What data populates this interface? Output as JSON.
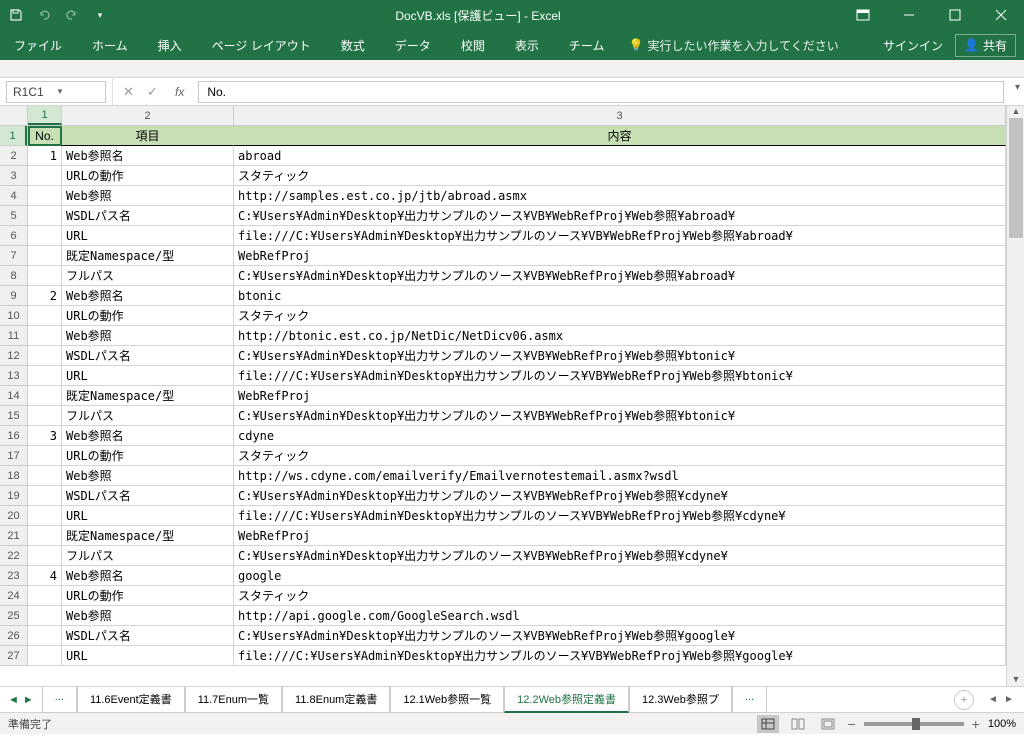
{
  "title": "DocVB.xls [保護ビュー] - Excel",
  "qat": {
    "save": "save",
    "undo": "undo",
    "redo": "redo"
  },
  "tabs": {
    "file": "ファイル",
    "home": "ホーム",
    "insert": "挿入",
    "pageLayout": "ページ レイアウト",
    "formulas": "数式",
    "data": "データ",
    "review": "校閲",
    "view": "表示",
    "team": "チーム"
  },
  "search_placeholder": "実行したい作業を入力してください",
  "signin": "サインイン",
  "share": "共有",
  "nameBox": "R1C1",
  "formula": "No.",
  "colHeaders": [
    "1",
    "2",
    "3"
  ],
  "rowHeaders": [
    "1",
    "2",
    "3",
    "4",
    "5",
    "6",
    "7",
    "8",
    "9",
    "10",
    "11",
    "12",
    "13",
    "14",
    "15",
    "16",
    "17",
    "18",
    "19",
    "20",
    "21",
    "22",
    "23",
    "24",
    "25",
    "26",
    "27"
  ],
  "headerRow": {
    "c1": "No.",
    "c2": "項目",
    "c3": "内容"
  },
  "rows": [
    {
      "n": "1",
      "k": "Web参照名",
      "v": "abroad"
    },
    {
      "n": "",
      "k": "URLの動作",
      "v": "スタティック"
    },
    {
      "n": "",
      "k": "Web参照",
      "v": "http://samples.est.co.jp/jtb/abroad.asmx"
    },
    {
      "n": "",
      "k": "WSDLパス名",
      "v": "C:¥Users¥Admin¥Desktop¥出力サンプルのソース¥VB¥WebRefProj¥Web参照¥abroad¥"
    },
    {
      "n": "",
      "k": "URL",
      "v": "file:///C:¥Users¥Admin¥Desktop¥出力サンプルのソース¥VB¥WebRefProj¥Web参照¥abroad¥"
    },
    {
      "n": "",
      "k": "既定Namespace/型",
      "v": "WebRefProj"
    },
    {
      "n": "",
      "k": "フルパス",
      "v": "C:¥Users¥Admin¥Desktop¥出力サンプルのソース¥VB¥WebRefProj¥Web参照¥abroad¥"
    },
    {
      "n": "2",
      "k": "Web参照名",
      "v": "btonic"
    },
    {
      "n": "",
      "k": "URLの動作",
      "v": "スタティック"
    },
    {
      "n": "",
      "k": "Web参照",
      "v": "http://btonic.est.co.jp/NetDic/NetDicv06.asmx"
    },
    {
      "n": "",
      "k": "WSDLパス名",
      "v": "C:¥Users¥Admin¥Desktop¥出力サンプルのソース¥VB¥WebRefProj¥Web参照¥btonic¥"
    },
    {
      "n": "",
      "k": "URL",
      "v": "file:///C:¥Users¥Admin¥Desktop¥出力サンプルのソース¥VB¥WebRefProj¥Web参照¥btonic¥"
    },
    {
      "n": "",
      "k": "既定Namespace/型",
      "v": "WebRefProj"
    },
    {
      "n": "",
      "k": "フルパス",
      "v": "C:¥Users¥Admin¥Desktop¥出力サンプルのソース¥VB¥WebRefProj¥Web参照¥btonic¥"
    },
    {
      "n": "3",
      "k": "Web参照名",
      "v": "cdyne"
    },
    {
      "n": "",
      "k": "URLの動作",
      "v": "スタティック"
    },
    {
      "n": "",
      "k": "Web参照",
      "v": "http://ws.cdyne.com/emailverify/Emailvernotestemail.asmx?wsdl"
    },
    {
      "n": "",
      "k": "WSDLパス名",
      "v": "C:¥Users¥Admin¥Desktop¥出力サンプルのソース¥VB¥WebRefProj¥Web参照¥cdyne¥"
    },
    {
      "n": "",
      "k": "URL",
      "v": "file:///C:¥Users¥Admin¥Desktop¥出力サンプルのソース¥VB¥WebRefProj¥Web参照¥cdyne¥"
    },
    {
      "n": "",
      "k": "既定Namespace/型",
      "v": "WebRefProj"
    },
    {
      "n": "",
      "k": "フルパス",
      "v": "C:¥Users¥Admin¥Desktop¥出力サンプルのソース¥VB¥WebRefProj¥Web参照¥cdyne¥"
    },
    {
      "n": "4",
      "k": "Web参照名",
      "v": "google"
    },
    {
      "n": "",
      "k": "URLの動作",
      "v": "スタティック"
    },
    {
      "n": "",
      "k": "Web参照",
      "v": "http://api.google.com/GoogleSearch.wsdl"
    },
    {
      "n": "",
      "k": "WSDLパス名",
      "v": "C:¥Users¥Admin¥Desktop¥出力サンプルのソース¥VB¥WebRefProj¥Web参照¥google¥"
    },
    {
      "n": "",
      "k": "URL",
      "v": "file:///C:¥Users¥Admin¥Desktop¥出力サンプルのソース¥VB¥WebRefProj¥Web参照¥google¥"
    }
  ],
  "sheets": {
    "s0": "...",
    "s1": "11.6Event定義書",
    "s2": "11.7Enum一覧",
    "s3": "11.8Enum定義書",
    "s4": "12.1Web参照一覧",
    "s5": "12.2Web参照定義書",
    "s6": "12.3Web参照プ",
    "s7": "..."
  },
  "status": "準備完了",
  "zoom": "100%"
}
